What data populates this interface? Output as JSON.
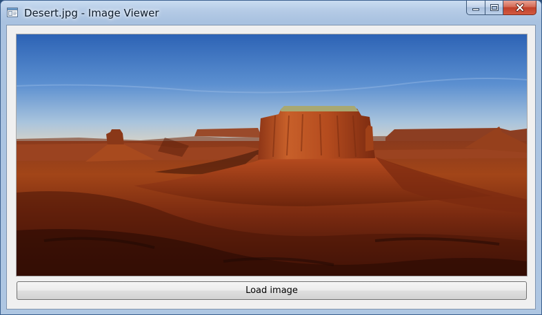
{
  "window": {
    "title": "Desert.jpg - Image Viewer",
    "caption_buttons": [
      "minimize",
      "maximize",
      "close"
    ]
  },
  "app_icon": "image-viewer-app-icon",
  "main": {
    "image": {
      "file": "Desert.jpg",
      "subject": "desert-buttes-landscape"
    },
    "load_button_label": "Load image"
  },
  "colors": {
    "titlebar": "#b5cbe6",
    "client_bg": "#f0f0f0",
    "close_button": "#c0402a",
    "sky_top": "#2f66b8",
    "rock": "#b2461c"
  }
}
